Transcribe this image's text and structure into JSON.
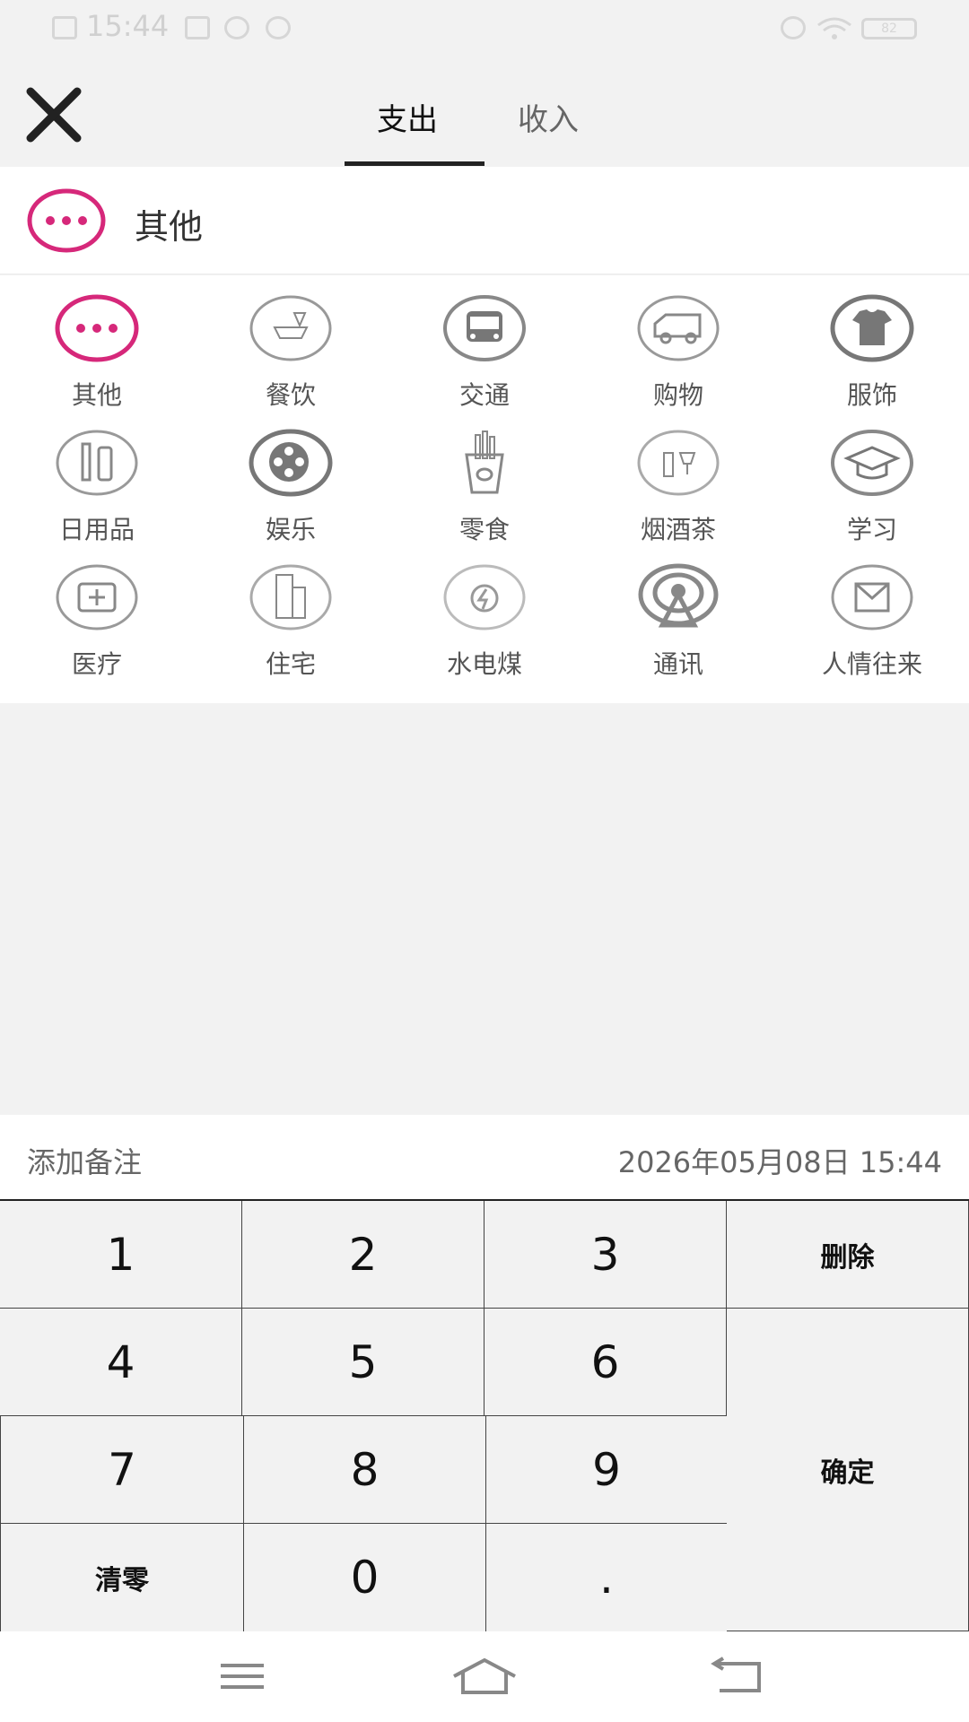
{
  "status_bar": {
    "time": "15:44",
    "battery": "82"
  },
  "header": {
    "tabs": [
      {
        "label": "支出",
        "active": true
      },
      {
        "label": "收入",
        "active": false
      }
    ]
  },
  "selected_category": {
    "label": "其他",
    "icon": "more-icon",
    "accent_color": "#d6287a"
  },
  "categories": [
    {
      "label": "其他",
      "icon": "more-icon"
    },
    {
      "label": "餐饮",
      "icon": "dining-icon"
    },
    {
      "label": "交通",
      "icon": "bus-icon"
    },
    {
      "label": "购物",
      "icon": "delivery-truck-icon"
    },
    {
      "label": "服饰",
      "icon": "tshirt-icon"
    },
    {
      "label": "日用品",
      "icon": "toiletries-icon"
    },
    {
      "label": "娱乐",
      "icon": "film-reel-icon"
    },
    {
      "label": "零食",
      "icon": "fries-icon"
    },
    {
      "label": "烟酒茶",
      "icon": "wine-icon"
    },
    {
      "label": "学习",
      "icon": "graduation-cap-icon"
    },
    {
      "label": "医疗",
      "icon": "medical-kit-icon"
    },
    {
      "label": "住宅",
      "icon": "building-icon"
    },
    {
      "label": "水电煤",
      "icon": "utilities-icon"
    },
    {
      "label": "通讯",
      "icon": "signal-tower-icon"
    },
    {
      "label": "人情往来",
      "icon": "red-envelope-icon"
    }
  ],
  "remark": {
    "placeholder": "添加备注",
    "datetime": "2026年05月08日 15:44"
  },
  "keypad": {
    "k1": "1",
    "k2": "2",
    "k3": "3",
    "delete": "删除",
    "k4": "4",
    "k5": "5",
    "k6": "6",
    "confirm": "确定",
    "k7": "7",
    "k8": "8",
    "k9": "9",
    "clear": "清零",
    "k0": "0",
    "dot": "."
  }
}
